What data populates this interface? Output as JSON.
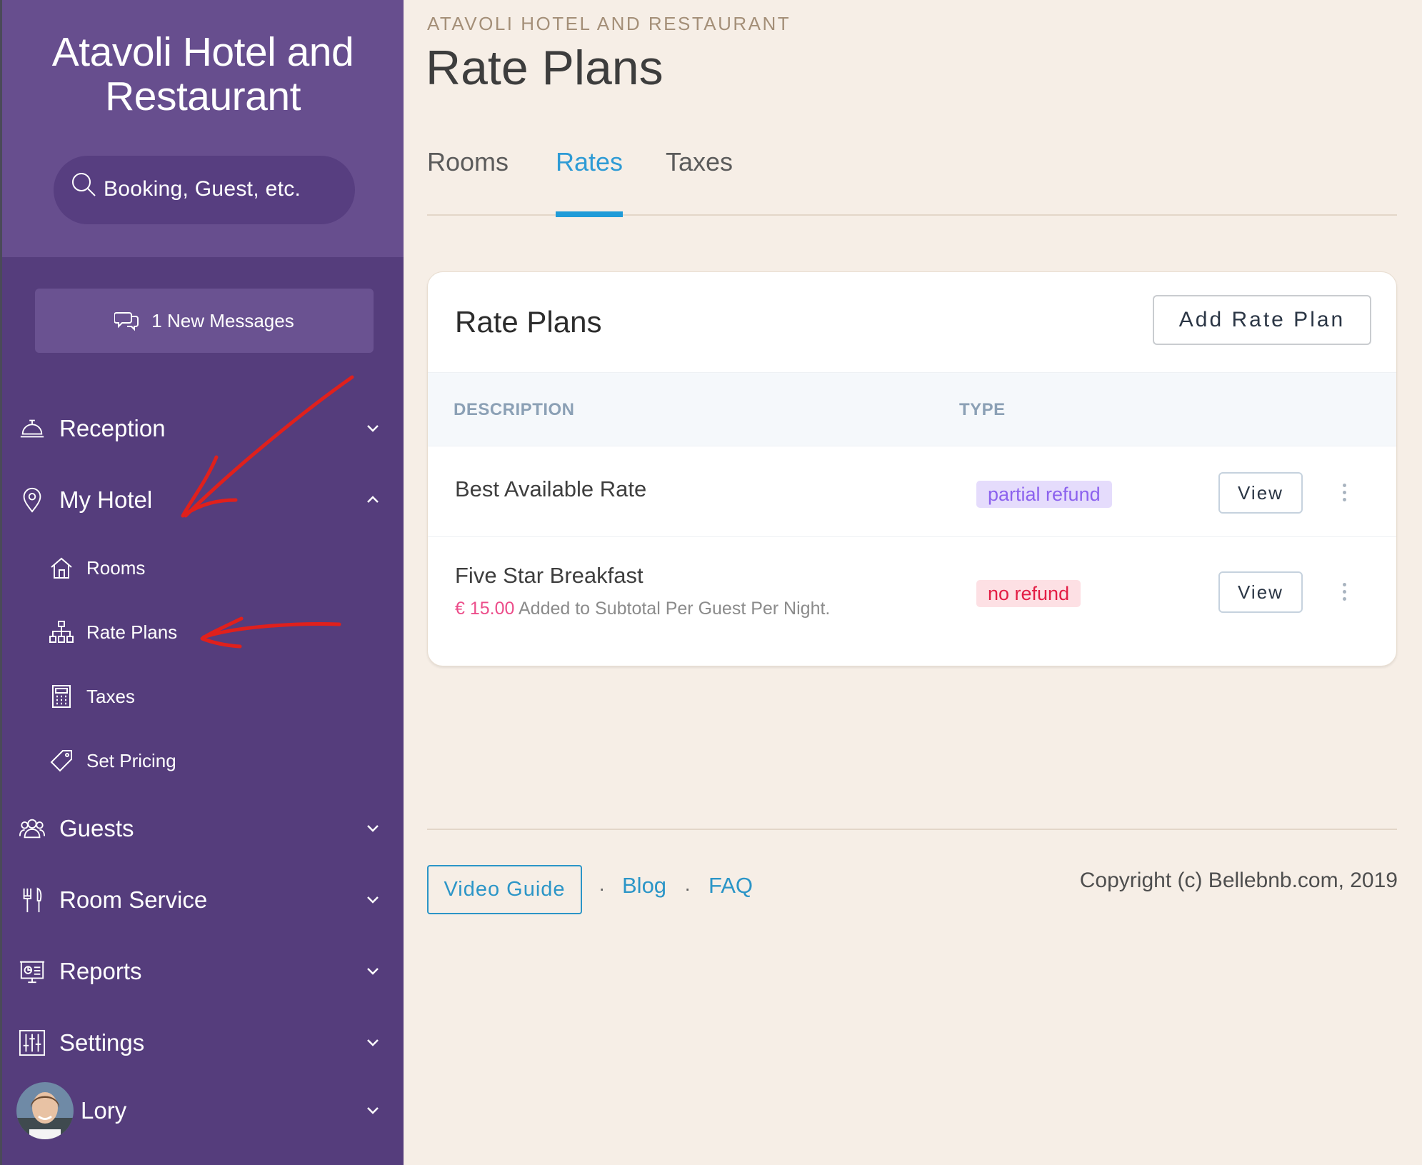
{
  "sidebar": {
    "hotel_name": "Atavoli Hotel and Restaurant",
    "search_placeholder": "Booking, Guest, etc.",
    "messages_label": "1 New Messages",
    "nav": {
      "reception": "Reception",
      "my_hotel": "My Hotel",
      "guests": "Guests",
      "room_service": "Room Service",
      "reports": "Reports",
      "settings": "Settings",
      "user": "Lory"
    },
    "my_hotel_sub": {
      "rooms": "Rooms",
      "rate_plans": "Rate Plans",
      "taxes": "Taxes",
      "set_pricing": "Set Pricing"
    }
  },
  "header": {
    "eyebrow": "ATAVOLI HOTEL AND RESTAURANT",
    "title": "Rate Plans"
  },
  "tabs": {
    "rooms": "Rooms",
    "rates": "Rates",
    "taxes": "Taxes",
    "active": "Rates"
  },
  "card": {
    "title": "Rate Plans",
    "add_button": "Add Rate Plan",
    "columns": {
      "description": "DESCRIPTION",
      "type": "TYPE"
    },
    "rows": [
      {
        "description": "Best Available Rate",
        "type": "partial refund",
        "view_label": "View"
      },
      {
        "description": "Five Star Breakfast",
        "amount": "€ 15.00",
        "note": "Added to Subtotal Per Guest Per Night.",
        "type": "no refund",
        "view_label": "View"
      }
    ]
  },
  "footer": {
    "video_guide": "Video Guide",
    "separator": "·",
    "blog": "Blog",
    "faq": "FAQ",
    "copyright": "Copyright (c) Bellebnb.com, 2019"
  },
  "colors": {
    "sidebar": "#553d7c",
    "sidebar_top": "#674e8e",
    "accent": "#2e9bd5",
    "page_bg": "#f6eee6",
    "annotation": "#e0201c"
  }
}
